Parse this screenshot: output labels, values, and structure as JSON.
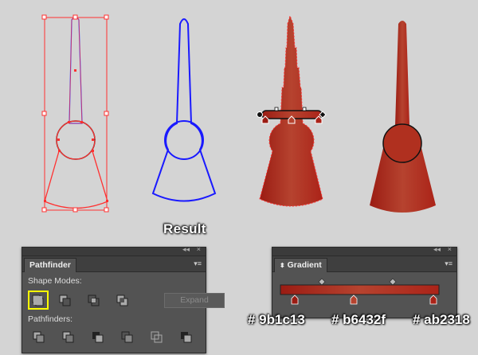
{
  "result_label": "Result",
  "pathfinder": {
    "tab_label": "Pathfinder",
    "shape_modes_label": "Shape Modes:",
    "pathfinders_label": "Pathfinders:",
    "expand_label": "Expand"
  },
  "gradient": {
    "tab_label": "Gradient",
    "stop_colors": [
      "#9b1c13",
      "#b6432f",
      "#ab2318"
    ],
    "stop_labels": [
      "# 9b1c13",
      "# b6432f",
      "# ab2318"
    ]
  },
  "colors": {
    "canvas": "#d4d4d4",
    "selection_red": "#ff3030",
    "outline_blue": "#1a1aff",
    "fill_red": "#b0301f",
    "highlight_yellow": "#ffff00"
  }
}
